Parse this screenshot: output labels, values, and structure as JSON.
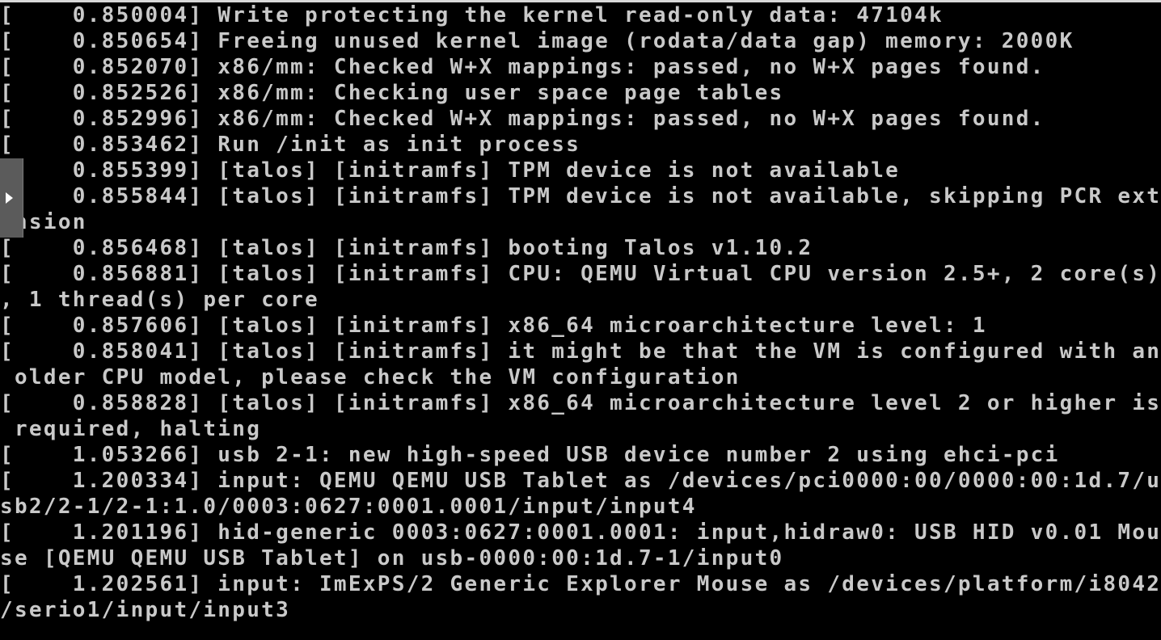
{
  "console": {
    "lines": [
      "[    0.850004] Write protecting the kernel read-only data: 47104k",
      "[    0.850654] Freeing unused kernel image (rodata/data gap) memory: 2000K",
      "[    0.852070] x86/mm: Checked W+X mappings: passed, no W+X pages found.",
      "[    0.852526] x86/mm: Checking user space page tables",
      "[    0.852996] x86/mm: Checked W+X mappings: passed, no W+X pages found.",
      "[    0.853462] Run /init as init process",
      "[    0.855399] [talos] [initramfs] TPM device is not available",
      "[    0.855844] [talos] [initramfs] TPM device is not available, skipping PCR ext",
      "ension",
      "[    0.856468] [talos] [initramfs] booting Talos v1.10.2",
      "[    0.856881] [talos] [initramfs] CPU: QEMU Virtual CPU version 2.5+, 2 core(s)",
      ", 1 thread(s) per core",
      "[    0.857606] [talos] [initramfs] x86_64 microarchitecture level: 1",
      "[    0.858041] [talos] [initramfs] it might be that the VM is configured with an",
      " older CPU model, please check the VM configuration",
      "[    0.858828] [talos] [initramfs] x86_64 microarchitecture level 2 or higher is",
      " required, halting",
      "[    1.053266] usb 2-1: new high-speed USB device number 2 using ehci-pci",
      "[    1.200334] input: QEMU QEMU USB Tablet as /devices/pci0000:00/0000:00:1d.7/u",
      "sb2/2-1/2-1:1.0/0003:0627:0001.0001/input/input4",
      "[    1.201196] hid-generic 0003:0627:0001.0001: input,hidraw0: USB HID v0.01 Mou",
      "se [QEMU QEMU USB Tablet] on usb-0000:00:1d.7-1/input0",
      "[    1.202561] input: ImExPS/2 Generic Explorer Mouse as /devices/platform/i8042",
      "/serio1/input/input3"
    ]
  },
  "side_panel": {
    "icon": "chevron-right-icon"
  },
  "colors": {
    "background": "#000000",
    "text": "#c9c9c9",
    "side_panel": "#5b5b5b"
  }
}
